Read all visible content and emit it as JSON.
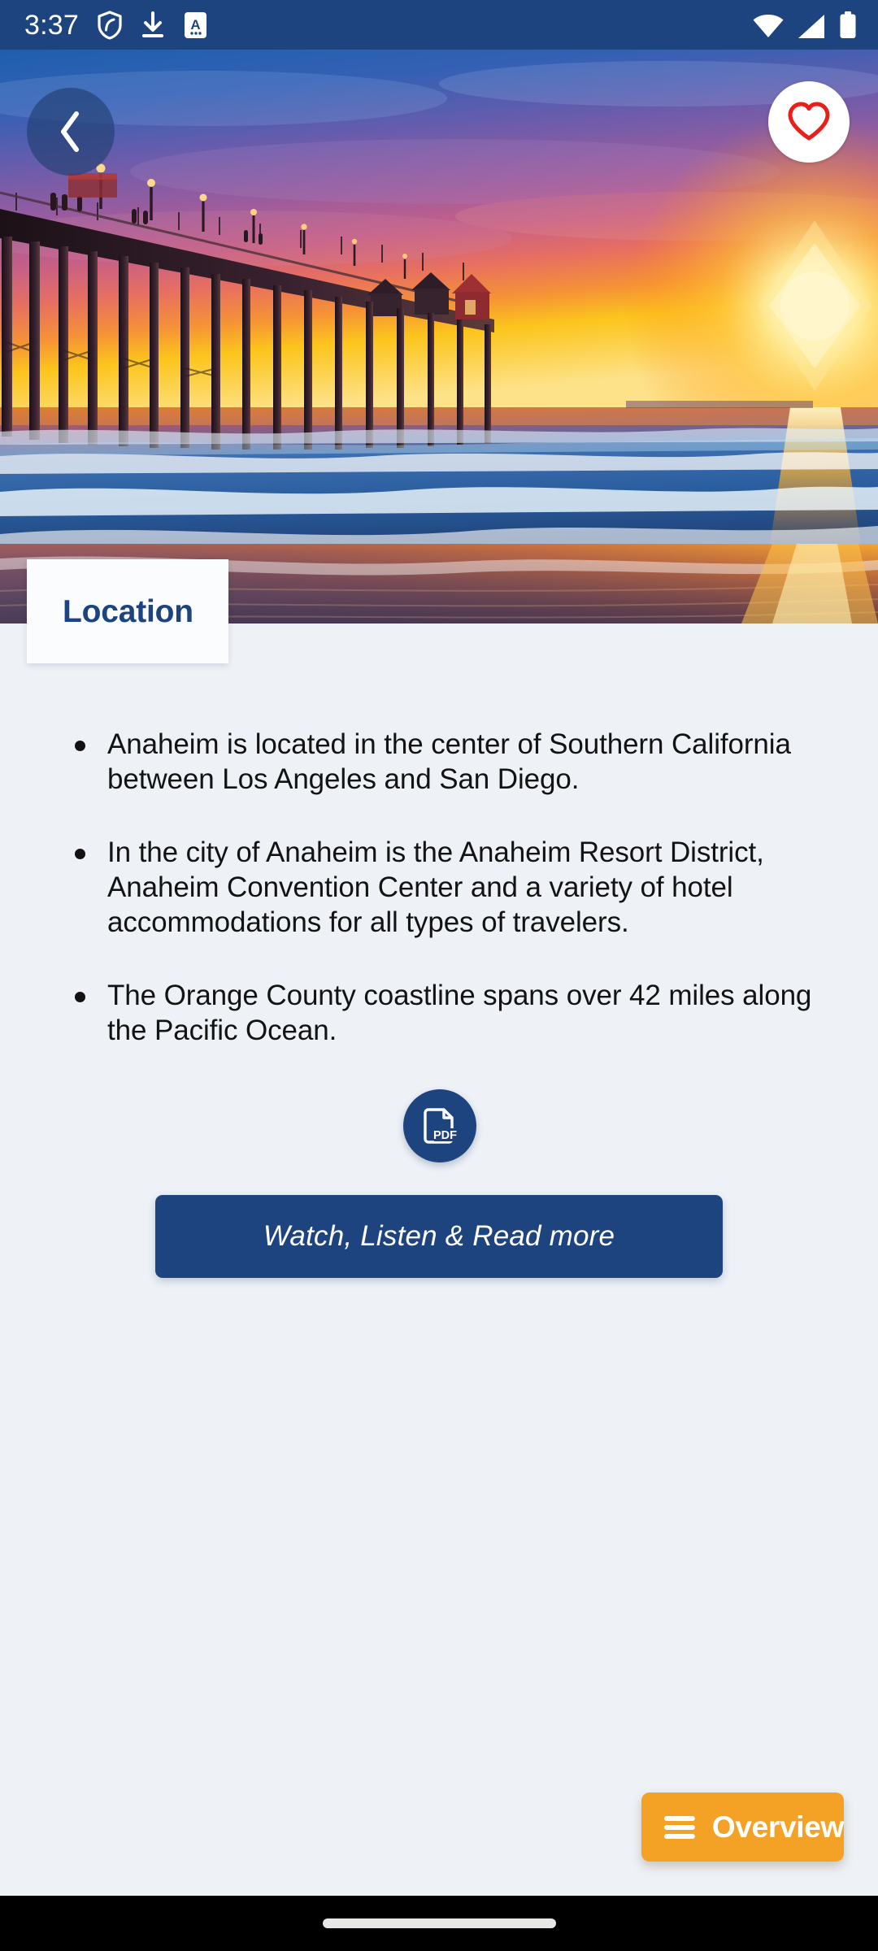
{
  "status_bar": {
    "time": "3:37",
    "left_icons": [
      "shield-icon",
      "download-icon",
      "translate-icon"
    ],
    "right_icons": [
      "wifi-icon",
      "cellular-signal-icon",
      "battery-icon"
    ],
    "background_color": "#1e4480"
  },
  "hero": {
    "image_description": "Huntington Beach Pier silhouette at sunset over the Pacific Ocean with reflections on wet sand",
    "back_button": {
      "icon": "chevron-left-icon",
      "label": "Back"
    },
    "favorite_button": {
      "icon": "heart-outline-icon",
      "label": "Favorite",
      "color": "#e8201c",
      "active": false
    }
  },
  "section_tab": {
    "label": "Location",
    "text_color": "#1e4480",
    "background_color": "#fbfcfd"
  },
  "content": {
    "background_color": "#eef2f7",
    "bullets": [
      "Anaheim is located in the center of Southern California between Los Angeles and San Diego.",
      "In the city of Anaheim is the Anaheim Resort District, Anaheim Convention Center and a variety of hotel accommodations for all types of travelers.",
      "The Orange County coastline spans over 42 miles along the Pacific Ocean."
    ],
    "pdf_button": {
      "icon": "pdf-document-icon",
      "label": "PDF",
      "color": "#1e4480"
    },
    "cta_button": {
      "label": "Watch, Listen & Read more",
      "color": "#1e4480",
      "text_color": "#ffffff"
    }
  },
  "overview_fab": {
    "label": "Overview",
    "icon": "hamburger-menu-icon",
    "background_color": "#f4a226",
    "text_color": "#ffffff"
  },
  "nav_bar": {
    "type": "gesture-pill",
    "background_color": "#000000"
  }
}
